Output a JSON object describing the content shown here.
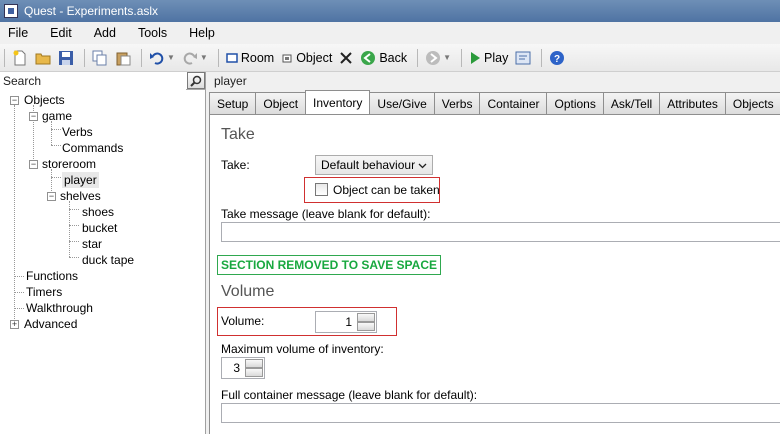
{
  "window": {
    "title": "Quest - Experiments.aslx"
  },
  "menu": [
    "File",
    "Edit",
    "Add",
    "Tools",
    "Help"
  ],
  "toolbar": {
    "room": "Room",
    "object": "Object",
    "back": "Back",
    "play": "Play"
  },
  "search": {
    "placeholder": "Search"
  },
  "tree": {
    "objects": "Objects",
    "game": "game",
    "verbs": "Verbs",
    "commands": "Commands",
    "storeroom": "storeroom",
    "player": "player",
    "shelves": "shelves",
    "shoes": "shoes",
    "bucket": "bucket",
    "star": "star",
    "duck_tape": "duck tape",
    "functions": "Functions",
    "timers": "Timers",
    "walkthrough": "Walkthrough",
    "advanced": "Advanced"
  },
  "editor": {
    "object_name": "player",
    "tabs": [
      "Setup",
      "Object",
      "Inventory",
      "Use/Give",
      "Verbs",
      "Container",
      "Options",
      "Ask/Tell",
      "Attributes",
      "Objects"
    ],
    "active_tab": "Inventory",
    "take": {
      "heading": "Take",
      "label": "Take:",
      "behaviour": "Default behaviour",
      "checkbox_label": "Object can be taken",
      "message_label": "Take message (leave blank for default):",
      "message_value": ""
    },
    "banner": "SECTION REMOVED TO SAVE SPACE",
    "volume": {
      "heading": "Volume",
      "volume_label": "Volume:",
      "volume_value": "1",
      "max_label": "Maximum volume of inventory:",
      "max_value": "3",
      "full_label": "Full container message (leave blank for default):",
      "full_value": ""
    }
  },
  "colors": {
    "annotation_red": "#d03030",
    "annotation_green": "#18a83f"
  }
}
